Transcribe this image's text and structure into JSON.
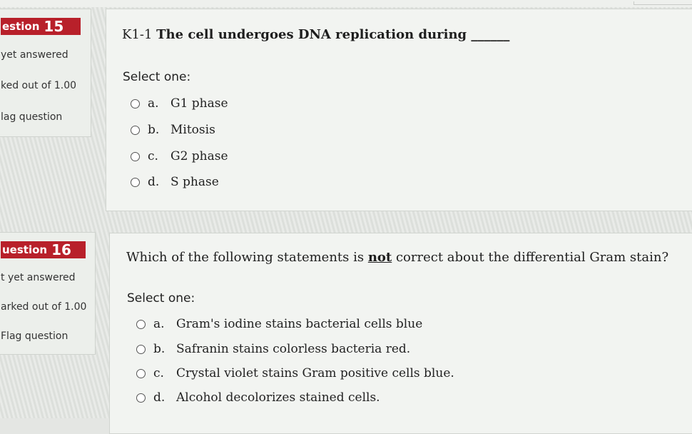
{
  "questions": [
    {
      "badge_label": "estion",
      "badge_number": "15",
      "status": "yet answered",
      "marks": "ked out of 1.00",
      "flag": "lag question",
      "text_prefix": "K1-1 ",
      "text_bold": "The cell undergoes DNA replication during ______",
      "select_one": "Select one:",
      "options": [
        {
          "letter": "a.",
          "text": "G1 phase"
        },
        {
          "letter": "b.",
          "text": "Mitosis"
        },
        {
          "letter": "c.",
          "text": "G2 phase"
        },
        {
          "letter": "d.",
          "text": "S phase"
        }
      ]
    },
    {
      "badge_label": "uestion",
      "badge_number": "16",
      "status": "t yet answered",
      "marks": "arked out of 1.00",
      "flag": "Flag question",
      "text_before": "Which of the following statements is ",
      "text_emph": "not",
      "text_after": " correct about the differential Gram stain?",
      "select_one": "Select one:",
      "options": [
        {
          "letter": "a.",
          "text": "Gram's iodine stains bacterial cells blue"
        },
        {
          "letter": "b.",
          "text": "Safranin stains colorless bacteria red."
        },
        {
          "letter": "c.",
          "text": "Crystal violet stains Gram positive cells blue."
        },
        {
          "letter": "d.",
          "text": "Alcohol decolorizes stained cells."
        }
      ]
    }
  ],
  "colors": {
    "badge": "#b8202a",
    "card_bg": "#f2f4f1",
    "page_bg": "#e4e6e3"
  }
}
